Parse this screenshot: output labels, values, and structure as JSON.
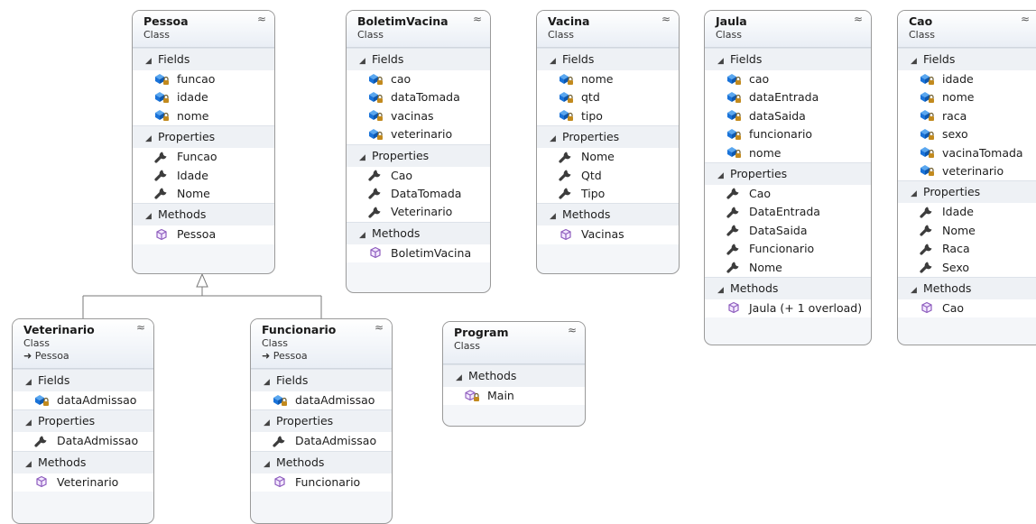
{
  "colors": {
    "border": "#9a9a9a",
    "header_bg": "#e9eef5",
    "field_icon": "#1a73d9",
    "property_icon": "#3c3c3c",
    "method_icon": "#8e5dbd",
    "inheritance_line": "#7a7a7a"
  },
  "icon_names": {
    "field": "private-field-icon",
    "property": "wrench-property-icon",
    "method": "method-cube-icon",
    "private_method": "private-method-icon",
    "collapse": "double-chevron-up-icon",
    "section_toggle": "expand-triangle-icon",
    "base_class": "inherits-arrow-icon"
  },
  "classes": {
    "pessoa": {
      "name": "Pessoa",
      "kind": "Class",
      "fields_label": "Fields",
      "fields": [
        "funcao",
        "idade",
        "nome"
      ],
      "properties_label": "Properties",
      "properties": [
        "Funcao",
        "Idade",
        "Nome"
      ],
      "methods_label": "Methods",
      "methods": [
        "Pessoa"
      ]
    },
    "boletim": {
      "name": "BoletimVacina",
      "kind": "Class",
      "fields_label": "Fields",
      "fields": [
        "cao",
        "dataTomada",
        "vacinas",
        "veterinario"
      ],
      "properties_label": "Properties",
      "properties": [
        "Cao",
        "DataTomada",
        "Veterinario"
      ],
      "methods_label": "Methods",
      "methods": [
        "BoletimVacina"
      ]
    },
    "vacina": {
      "name": "Vacina",
      "kind": "Class",
      "fields_label": "Fields",
      "fields": [
        "nome",
        "qtd",
        "tipo"
      ],
      "properties_label": "Properties",
      "properties": [
        "Nome",
        "Qtd",
        "Tipo"
      ],
      "methods_label": "Methods",
      "methods": [
        "Vacinas"
      ]
    },
    "jaula": {
      "name": "Jaula",
      "kind": "Class",
      "fields_label": "Fields",
      "fields": [
        "cao",
        "dataEntrada",
        "dataSaida",
        "funcionario",
        "nome"
      ],
      "properties_label": "Properties",
      "properties": [
        "Cao",
        "DataEntrada",
        "DataSaida",
        "Funcionario",
        "Nome"
      ],
      "methods_label": "Methods",
      "methods": [
        "Jaula (+ 1 overload)"
      ]
    },
    "cao": {
      "name": "Cao",
      "kind": "Class",
      "fields_label": "Fields",
      "fields": [
        "idade",
        "nome",
        "raca",
        "sexo",
        "vacinaTomada",
        "veterinario"
      ],
      "properties_label": "Properties",
      "properties": [
        "Idade",
        "Nome",
        "Raca",
        "Sexo"
      ],
      "methods_label": "Methods",
      "methods": [
        "Cao"
      ]
    },
    "veterinario": {
      "name": "Veterinario",
      "kind": "Class",
      "base": "Pessoa",
      "fields_label": "Fields",
      "fields": [
        "dataAdmissao"
      ],
      "properties_label": "Properties",
      "properties": [
        "DataAdmissao"
      ],
      "methods_label": "Methods",
      "methods": [
        "Veterinario"
      ]
    },
    "funcionario": {
      "name": "Funcionario",
      "kind": "Class",
      "base": "Pessoa",
      "fields_label": "Fields",
      "fields": [
        "dataAdmissao"
      ],
      "properties_label": "Properties",
      "properties": [
        "DataAdmissao"
      ],
      "methods_label": "Methods",
      "methods": [
        "Funcionario"
      ]
    },
    "program": {
      "name": "Program",
      "kind": "Class",
      "methods_label": "Methods",
      "private_methods": [
        "Main"
      ]
    }
  }
}
